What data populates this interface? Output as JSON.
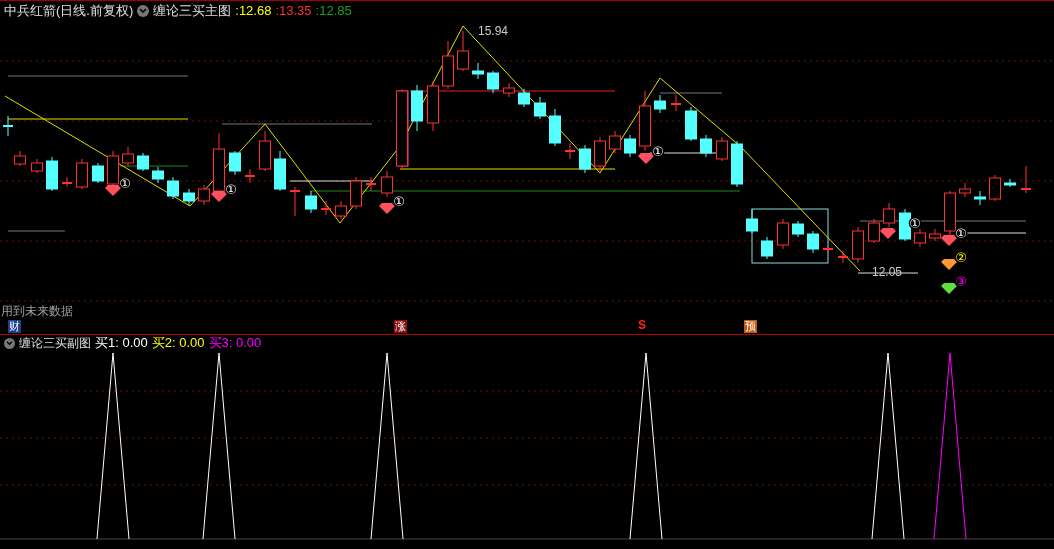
{
  "header": {
    "stock_title": "中兵红箭(日线.前复权)",
    "indicator": "缠论三买主图",
    "values": [
      {
        "text": ":12.68",
        "color": "#ffff00"
      },
      {
        "text": ":13.35",
        "color": "#ff3030"
      },
      {
        "text": ":12.85",
        "color": "#20a020"
      }
    ]
  },
  "main_chart": {
    "price_labels": [
      "15.94",
      "12.05"
    ],
    "signals": [
      {
        "kind": "buy1",
        "label": "①"
      },
      {
        "kind": "buy1",
        "label": "①"
      },
      {
        "kind": "buy1",
        "label": "①"
      },
      {
        "kind": "buy1",
        "label": "①"
      },
      {
        "kind": "buy1",
        "label": "①"
      },
      {
        "kind": "buy1",
        "label": "①"
      },
      {
        "kind": "buy2",
        "label": "②"
      },
      {
        "kind": "buy3",
        "label": "③"
      }
    ],
    "note": "用到未来数据"
  },
  "event_markers": [
    {
      "kind": "badge",
      "text": "财",
      "color": "#1e3f8c"
    },
    {
      "kind": "badge",
      "text": "涨",
      "color": "#8b1010"
    },
    {
      "kind": "letter",
      "text": "S",
      "color": "#ff2020"
    },
    {
      "kind": "badge",
      "text": "预",
      "color": "#c05a10"
    }
  ],
  "sub_chart": {
    "title": "缠论三买副图",
    "values": [
      {
        "text": "买1: 0.00",
        "color": "#ffffff"
      },
      {
        "text": "买2: 0.00",
        "color": "#ffff00"
      },
      {
        "text": "买3: 0.00",
        "color": "#ff00ff"
      }
    ]
  }
}
